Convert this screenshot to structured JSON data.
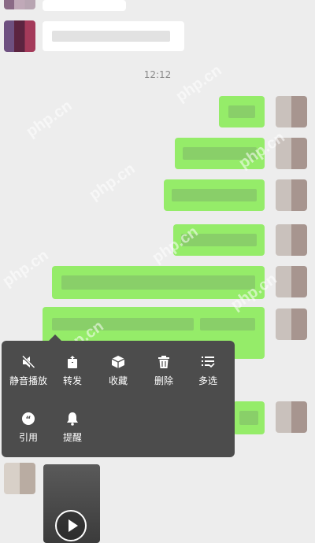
{
  "chat": {
    "timestamp": "12:12"
  },
  "context_menu": {
    "items": [
      {
        "label": "静音播放",
        "icon": "mute-speaker-icon"
      },
      {
        "label": "转发",
        "icon": "forward-icon"
      },
      {
        "label": "收藏",
        "icon": "favorite-box-icon"
      },
      {
        "label": "删除",
        "icon": "trash-icon"
      },
      {
        "label": "多选",
        "icon": "multi-select-icon"
      },
      {
        "label": "引用",
        "icon": "quote-icon"
      },
      {
        "label": "提醒",
        "icon": "bell-icon"
      }
    ]
  },
  "colors": {
    "background": "#ededed",
    "outgoing_bubble": "#95ec69",
    "incoming_bubble": "#ffffff",
    "menu_background": "#4c4c4c"
  },
  "watermark": "php.cn"
}
